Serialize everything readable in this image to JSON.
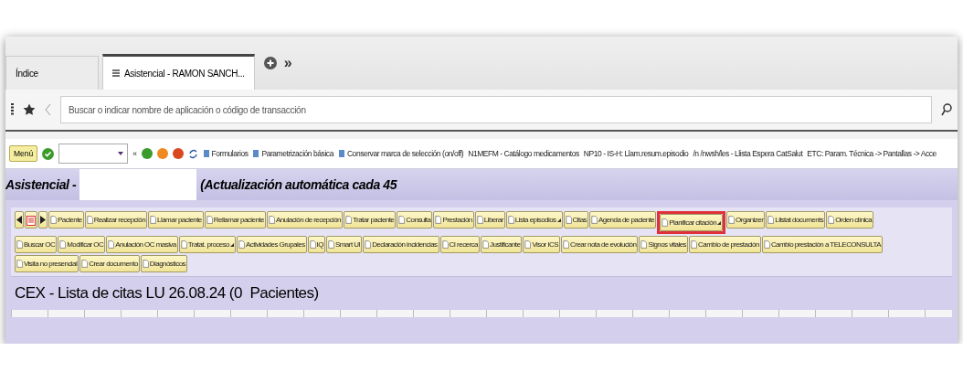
{
  "tabs": [
    {
      "label": "Índice",
      "selected": false
    },
    {
      "label": "Asistencial - RAMON SANCH...",
      "selected": true
    }
  ],
  "tab_overflow": "»",
  "address_bar": {
    "placeholder": "Buscar o indicar nombre de aplicación o código de transacción"
  },
  "toolbar": {
    "menu_button": "Menú",
    "back": "«",
    "links": [
      "Formularios",
      "Parametrización básica",
      "Conservar marca de selección (on/off)"
    ],
    "shortcuts": [
      "N1MEFM - Catálogo medicamentos",
      "NP10 - IS-H: Llam.resum.episodio",
      "/n /nwsh/les - Llista Espera CatSalut",
      "ETC: Param. Técnica -> Pantallas -> Acce"
    ]
  },
  "header": {
    "title_start": "Asistencial -",
    "title_end": "(Actualización automática cada 45"
  },
  "action_rows": [
    [
      {
        "kind": "prev"
      },
      {
        "kind": "calendar"
      },
      {
        "kind": "next"
      },
      {
        "kind": "action",
        "label": "Paciente",
        "dropdown": false,
        "highlighted": false
      },
      {
        "kind": "action",
        "label": "Realizar recepción",
        "dropdown": false,
        "highlighted": false
      },
      {
        "kind": "action",
        "label": "Llamar paciente",
        "dropdown": false,
        "highlighted": false
      },
      {
        "kind": "action",
        "label": "Rellamar paciente",
        "dropdown": false,
        "highlighted": false
      },
      {
        "kind": "action",
        "label": "Anulación de recepción",
        "dropdown": false,
        "highlighted": false
      },
      {
        "kind": "action",
        "label": "Tratar paciente",
        "dropdown": false,
        "highlighted": false
      },
      {
        "kind": "action",
        "label": "Consulta",
        "dropdown": false,
        "highlighted": false
      },
      {
        "kind": "action",
        "label": "Prestación",
        "dropdown": false,
        "highlighted": false
      },
      {
        "kind": "action",
        "label": "Liberar",
        "dropdown": false,
        "highlighted": false
      },
      {
        "kind": "action",
        "label": "Lista episodios",
        "dropdown": true,
        "highlighted": false
      },
      {
        "kind": "action",
        "label": "Citas",
        "dropdown": false,
        "highlighted": false
      },
      {
        "kind": "action",
        "label": "Agenda de paciente",
        "dropdown": false,
        "highlighted": false
      },
      {
        "kind": "action",
        "label": "Planificar citación",
        "dropdown": true,
        "highlighted": true
      },
      {
        "kind": "action",
        "label": "Organizer",
        "dropdown": false,
        "highlighted": false
      },
      {
        "kind": "action",
        "label": "Llistat documents",
        "dropdown": false,
        "highlighted": false
      },
      {
        "kind": "action",
        "label": "Orden clínica",
        "dropdown": false,
        "highlighted": false
      }
    ],
    [
      {
        "kind": "action",
        "label": "Buscar OC",
        "dropdown": false,
        "highlighted": false
      },
      {
        "kind": "action",
        "label": "Modificar OC",
        "dropdown": false,
        "highlighted": false
      },
      {
        "kind": "action",
        "label": "Anulación OC masiva",
        "dropdown": false,
        "highlighted": false
      },
      {
        "kind": "action",
        "label": "Tratat. proceso",
        "dropdown": true,
        "highlighted": false
      },
      {
        "kind": "action",
        "label": "Actividades Grupales",
        "dropdown": false,
        "highlighted": false
      },
      {
        "kind": "action",
        "label": "IQ",
        "dropdown": false,
        "highlighted": false
      },
      {
        "kind": "action",
        "label": "Smart UI",
        "dropdown": false,
        "highlighted": false
      },
      {
        "kind": "action",
        "label": "Declaración incidencias",
        "dropdown": false,
        "highlighted": false
      },
      {
        "kind": "action",
        "label": "CI recerca",
        "dropdown": false,
        "highlighted": false
      },
      {
        "kind": "action",
        "label": "Justificante",
        "dropdown": false,
        "highlighted": false
      },
      {
        "kind": "action",
        "label": "Visor ICS",
        "dropdown": false,
        "highlighted": false
      },
      {
        "kind": "action",
        "label": "Crear nota de evolución",
        "dropdown": false,
        "highlighted": false
      },
      {
        "kind": "action",
        "label": "Signos vitales",
        "dropdown": false,
        "highlighted": false
      },
      {
        "kind": "action",
        "label": "Cambio de prestación",
        "dropdown": false,
        "highlighted": false
      },
      {
        "kind": "action",
        "label": "Cambio prestación a TELECONSULTA",
        "dropdown": false,
        "highlighted": false
      }
    ],
    [
      {
        "kind": "action",
        "label": "Visita no presencial",
        "dropdown": false,
        "highlighted": false
      },
      {
        "kind": "action",
        "label": "Crear documento",
        "dropdown": false,
        "highlighted": false
      },
      {
        "kind": "action",
        "label": "Diagnósticos",
        "dropdown": false,
        "highlighted": false
      }
    ]
  ],
  "list_title": "CEX - Lista de citas LU 26.08.24 (0  Pacientes)"
}
